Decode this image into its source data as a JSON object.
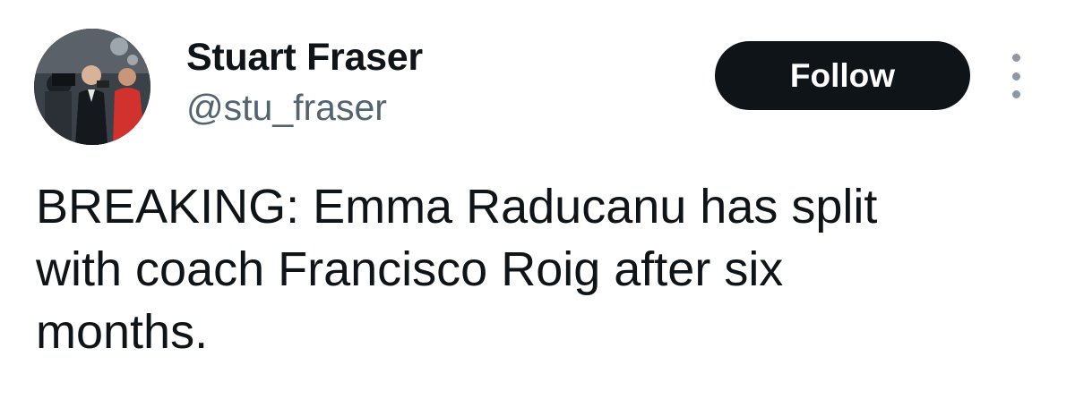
{
  "author": {
    "display_name": "Stuart Fraser",
    "handle": "@stu_fraser",
    "avatar_icon": "profile-photo"
  },
  "actions": {
    "follow_label": "Follow",
    "more_icon": "vertical-ellipsis-icon"
  },
  "tweet": {
    "text": "BREAKING: Emma Raducanu has split\nwith coach Francisco Roig after six\nmonths."
  },
  "colors": {
    "text_primary": "#0f1419",
    "text_secondary": "#536471",
    "follow_bg": "#0f1419",
    "follow_text": "#ffffff"
  }
}
